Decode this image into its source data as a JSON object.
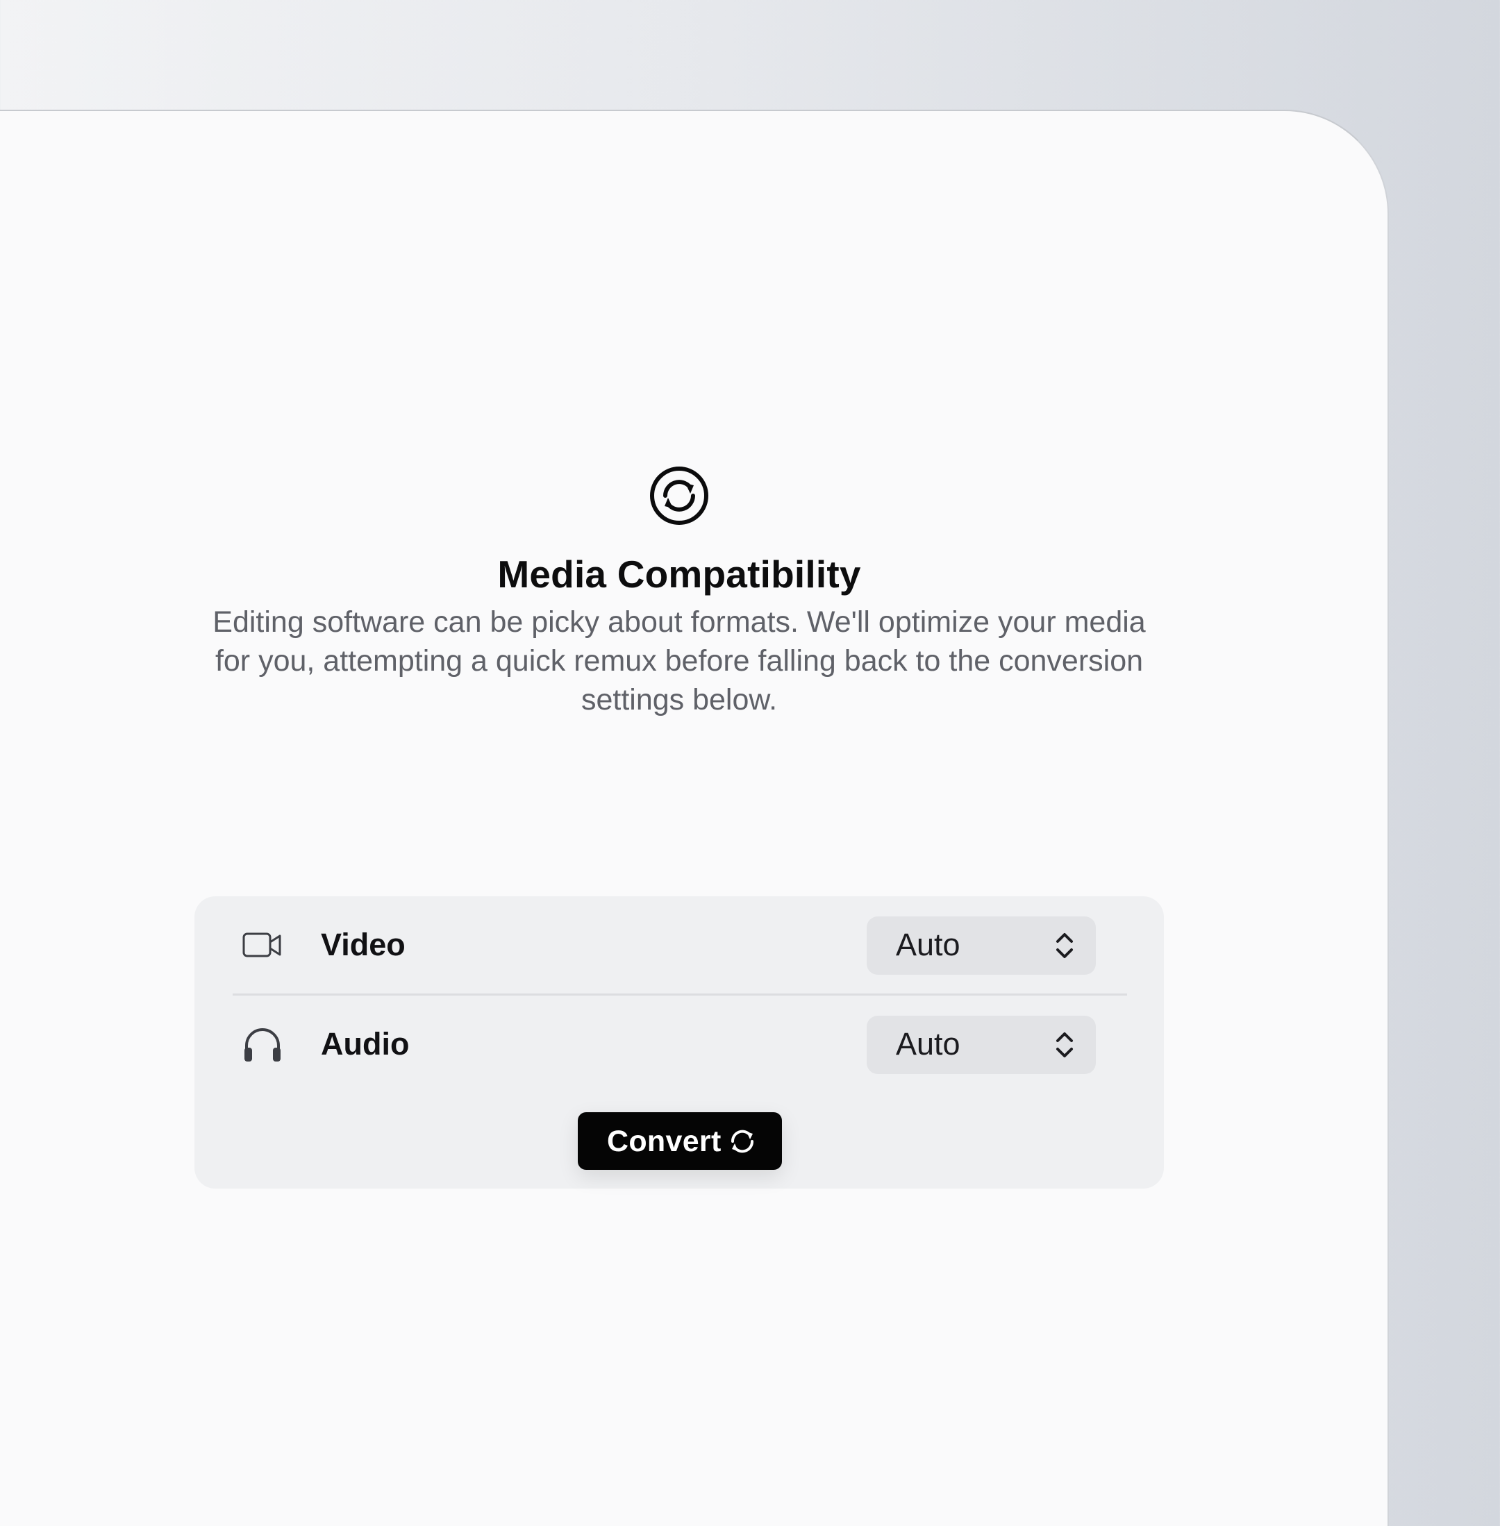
{
  "header": {
    "title": "Media Compatibility",
    "description": "Editing software can be picky about formats. We'll optimize your media for you, attempting a quick remux before falling back to the conversion settings below."
  },
  "settings": {
    "video": {
      "label": "Video",
      "value": "Auto",
      "icon": "video-camera-icon"
    },
    "audio": {
      "label": "Audio",
      "value": "Auto",
      "icon": "headphones-icon"
    }
  },
  "actions": {
    "convert_label": "Convert"
  },
  "colors": {
    "button_bg": "#050505",
    "panel_bg": "#eff0f2",
    "select_bg": "#e2e3e6",
    "description_text": "#5f6168"
  }
}
